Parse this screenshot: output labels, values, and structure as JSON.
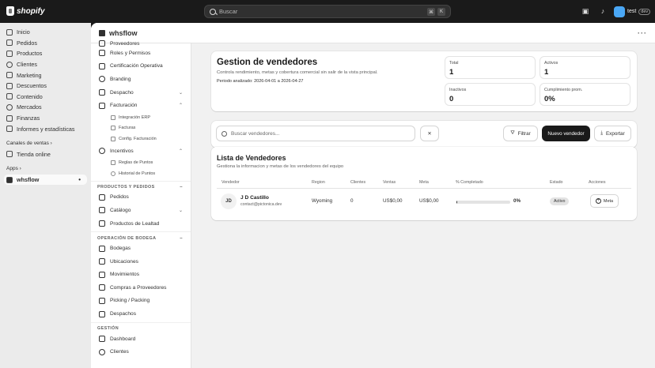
{
  "topbar": {
    "brand": "shopify",
    "search_placeholder": "Buscar",
    "shortcut_keys": [
      "⌘",
      "K"
    ],
    "store_name": "test",
    "store_tag": "dev"
  },
  "sidebar": {
    "items": [
      "Inicio",
      "Pedidos",
      "Productos",
      "Clientes",
      "Marketing",
      "Descuentos",
      "Contenido",
      "Mercados",
      "Finanzas",
      "Informes y estadísticas"
    ],
    "sales_channels_label": "Canales de ventas",
    "sales_channels": [
      "Tienda online"
    ],
    "apps_label": "Apps",
    "apps": [
      "whsflow"
    ]
  },
  "app": {
    "title": "whsflow",
    "menu_dots": "···"
  },
  "app_nav": {
    "top_items": [
      {
        "label": "Proveedores"
      },
      {
        "label": "Roles y Permisos"
      },
      {
        "label": "Certificación Operativa"
      },
      {
        "label": "Branding"
      },
      {
        "label": "Despacho",
        "chev": "⌄"
      },
      {
        "label": "Facturación",
        "chev": "⌃"
      }
    ],
    "facturacion_sub": [
      "Integración ERP",
      "Facturas",
      "Config. Facturación"
    ],
    "incentivos": {
      "label": "Incentivos",
      "chev": "⌃"
    },
    "incentivos_sub": [
      "Reglas de Puntos",
      "Historial de Puntos"
    ],
    "section_productos": "PRODUCTOS Y PEDIDOS",
    "productos_items": [
      {
        "label": "Pedidos"
      },
      {
        "label": "Catálogo",
        "chev": "⌄"
      },
      {
        "label": "Productos de Lealtad"
      }
    ],
    "section_bodega": "OPERACIÓN DE BODEGA",
    "bodega_items": [
      "Bodegas",
      "Ubicaciones",
      "Movimientos",
      "Compras a Proveedores",
      "Picking / Packing",
      "Despachos"
    ],
    "section_gestion": "GESTIÓN",
    "gestion_items": [
      "Dashboard",
      "Clientes"
    ]
  },
  "hero": {
    "title": "Gestion de vendedores",
    "subtitle": "Controla rendimiento, metas y cobertura comercial sin salir de la vista principal.",
    "period": "Periodo analizado: 2026-04-01 a 2026-04-27",
    "stats": [
      {
        "label": "Total",
        "value": "1"
      },
      {
        "label": "Activos",
        "value": "1"
      },
      {
        "label": "Inactivos",
        "value": "0"
      },
      {
        "label": "Cumplimiento prom.",
        "value": "0%"
      }
    ]
  },
  "toolbar": {
    "search_placeholder": "Buscar vendedores...",
    "clear_label": "✕",
    "filter_label": "Filtrar",
    "new_label": "Nuevo vendedor",
    "export_label": "Exportar"
  },
  "list": {
    "title": "Lista de Vendedores",
    "subtitle": "Gestiona la informacion y metas de los vendedores del equipo",
    "columns": [
      "Vendedor",
      "Region",
      "Clientes",
      "Ventas",
      "Meta",
      "% Completado",
      "Estado",
      "Acciones"
    ],
    "rows": [
      {
        "initials": "JD",
        "name": "J D Castillo",
        "email": "contact@pictonica.dev",
        "region": "Wyoming",
        "clientes": "0",
        "ventas": "US$0,00",
        "meta": "US$0,00",
        "completado": "0%",
        "completado_fraction": 0.01,
        "estado": "Activo",
        "accion": "Meta"
      }
    ]
  }
}
